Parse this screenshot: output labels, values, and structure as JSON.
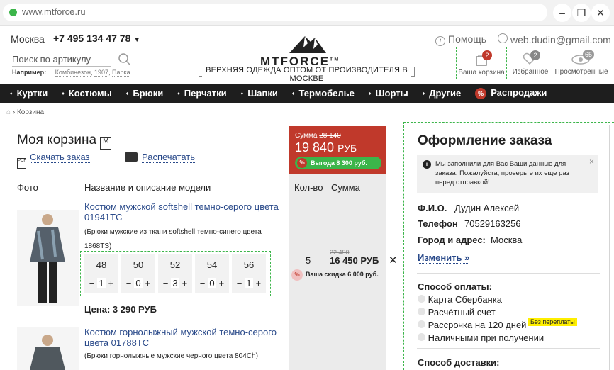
{
  "browser": {
    "url": "www.mtforce.ru"
  },
  "header": {
    "city": "Москва",
    "phone": "+7 495 134 47 78",
    "search_placeholder": "Поиск по артикулу",
    "example_label": "Например:",
    "examples": [
      "Комбинезон",
      "1907",
      "Парка"
    ],
    "logo_text": "MTFORCE",
    "tagline": "ВЕРХНЯЯ ОДЕЖДА ОПТОМ ОТ ПРОИЗВОДИТЕЛЯ В МОСКВЕ",
    "help": "Помощь",
    "email": "web.dudin@gmail.com",
    "cart_label": "Ваша корзина",
    "cart_count": "2",
    "fav_label": "Избранное",
    "fav_count": "2",
    "viewed_label": "Просмотренные",
    "viewed_count": "65"
  },
  "nav": {
    "items": [
      "Куртки",
      "Костюмы",
      "Брюки",
      "Перчатки",
      "Шапки",
      "Термобелье",
      "Шорты",
      "Другие",
      "Распродажи"
    ]
  },
  "breadcrumb": {
    "current": "Корзина"
  },
  "cart": {
    "title": "Моя корзина",
    "download": "Скачать заказ",
    "print": "Распечатать",
    "summary_label": "Сумма",
    "summary_old": "28 140",
    "summary_new": "19 840",
    "summary_currency": "РУБ",
    "saving": "Выгода 8 300 руб.",
    "columns": {
      "photo": "Фото",
      "name": "Название и описание модели",
      "qty": "Кол-во",
      "sum": "Сумма"
    },
    "items": [
      {
        "title": "Костюм мужской softshell темно-серого цвета 01941ТС",
        "desc": "(Брюки мужские из ткани softshell темно-синего цвета 1868TS)",
        "sizes": [
          {
            "size": "48",
            "qty": "1"
          },
          {
            "size": "50",
            "qty": "0"
          },
          {
            "size": "52",
            "qty": "3"
          },
          {
            "size": "54",
            "qty": "0"
          },
          {
            "size": "56",
            "qty": "1"
          }
        ],
        "price": "Цена: 3 290  РУБ",
        "qty": "5",
        "old_sum": "22 450",
        "sum": "16 450 РУБ",
        "discount": "Ваша скидка 6 000 руб."
      },
      {
        "title": "Костюм горнолыжный мужской темно-серого цвета 01788ТС",
        "desc": "(Брюки горнолыжные мужские черного цвета 804Ch)"
      }
    ]
  },
  "checkout": {
    "title": "Оформление заказа",
    "notice": "Мы заполнили для Вас Ваши данные для заказа. Пожалуйста, проверьте их еще раз перед отправкой!",
    "fio_label": "Ф.И.О.",
    "fio": "Дудин Алексей",
    "phone_label": "Телефон",
    "phone": "70529163256",
    "address_label": "Город и адрес:",
    "address": "Москва",
    "change": "Изменить »",
    "payment_label": "Способ оплаты:",
    "payment_options": [
      "Карта Сбербанка",
      "Расчётный счет",
      "Рассрочка на 120 дней",
      "Наличными при получении"
    ],
    "installment_badge": "Без переплаты",
    "delivery_label": "Способ доставки:"
  }
}
